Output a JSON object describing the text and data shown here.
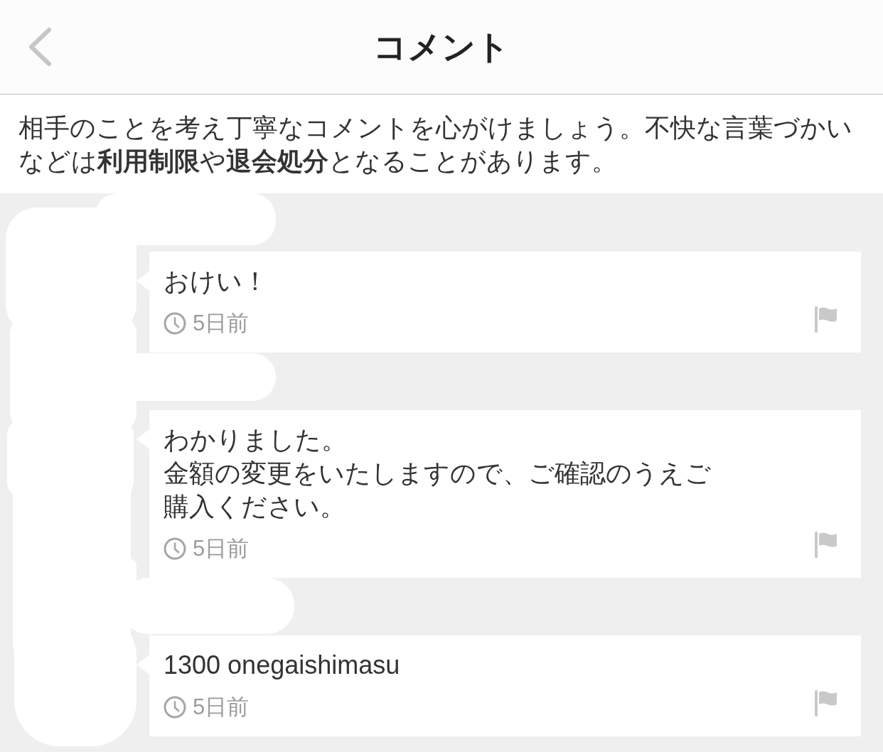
{
  "header": {
    "title": "コメント"
  },
  "notice": {
    "text": "相手のことを考え丁寧なコメントを心がけましょう。不快な言葉づかいなどは**利用制限**や**退会処分**となることがあります。"
  },
  "comments": [
    {
      "lines": [
        "おけい！"
      ],
      "time": "5日前"
    },
    {
      "lines": [
        "わかりました。",
        "金額の変更をいたしますので、ご確認のうえご",
        "購入ください。"
      ],
      "time": "5日前"
    },
    {
      "lines": [
        "1300 onegaishimasu"
      ],
      "time": "5日前"
    }
  ]
}
